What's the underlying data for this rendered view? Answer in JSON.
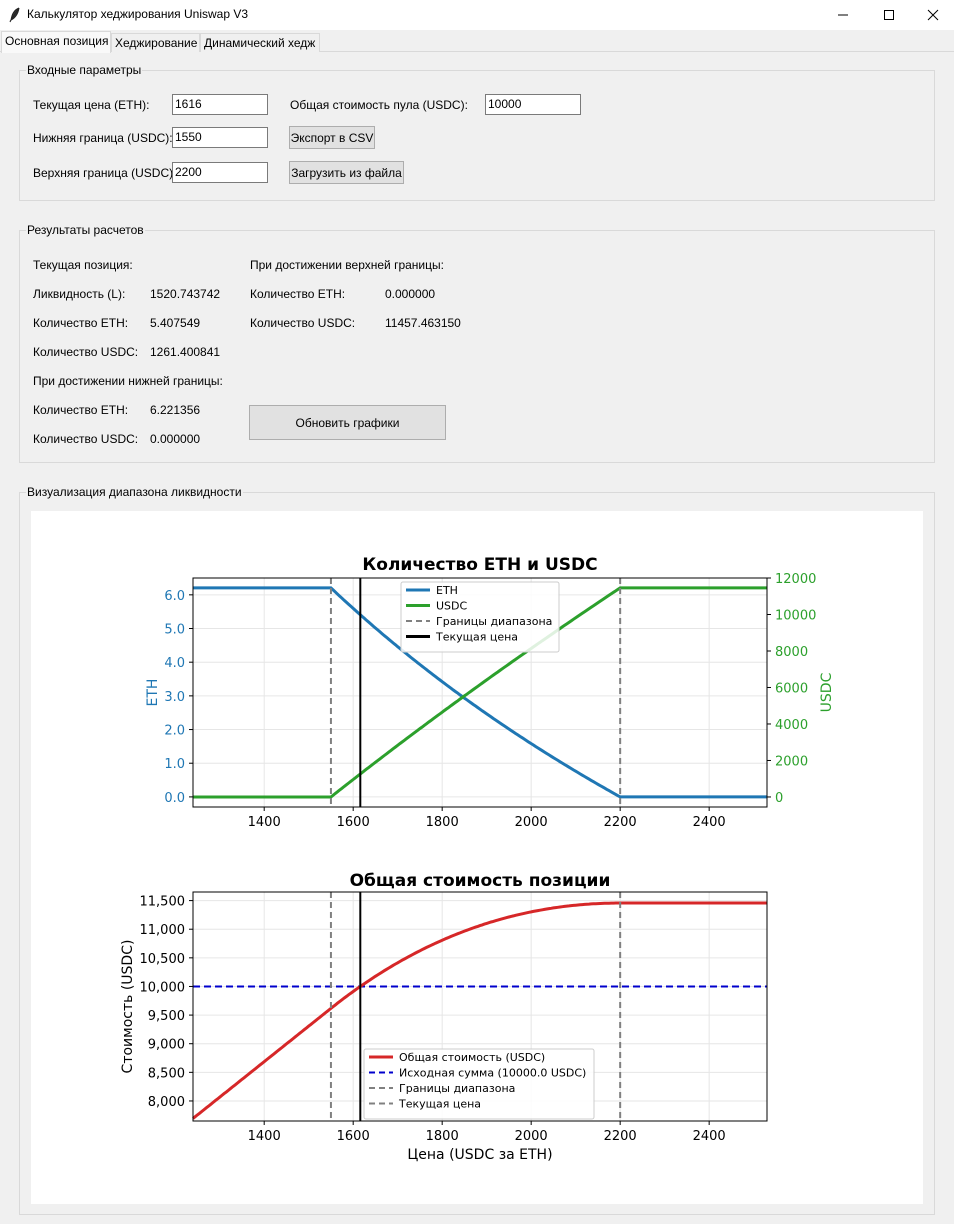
{
  "window": {
    "title": "Калькулятор хеджирования Uniswap V3",
    "icon": "feather-icon"
  },
  "tabs": [
    {
      "label": "Основная позиция"
    },
    {
      "label": "Хеджирование"
    },
    {
      "label": "Динамический хедж"
    }
  ],
  "inputs": {
    "title": "Входные параметры",
    "current_price_label": "Текущая цена (ETH):",
    "current_price": "1616",
    "lower_label": "Нижняя граница (USDC):",
    "lower": "1550",
    "upper_label": "Верхняя граница (USDC):",
    "upper": "2200",
    "pool_label": "Общая стоимость пула (USDC):",
    "pool": "10000",
    "export_button": "Экспорт в CSV",
    "load_button": "Загрузить из файла"
  },
  "results": {
    "title": "Результаты расчетов",
    "current_heading": "Текущая позиция:",
    "liquidity_label": "Ликвидность (L):",
    "liquidity": "1520.743742",
    "eth_label": "Количество ETH:",
    "eth": "5.407549",
    "usdc_label": "Количество USDC:",
    "usdc": "1261.400841",
    "lower_heading": "При достижении нижней границы:",
    "lower_eth_label": "Количество ETH:",
    "lower_eth": "6.221356",
    "lower_usdc_label": "Количество USDC:",
    "lower_usdc": "0.000000",
    "upper_heading": "При достижении верхней границы:",
    "upper_eth_label": "Количество ETH:",
    "upper_eth": "0.000000",
    "upper_usdc_label": "Количество USDC:",
    "upper_usdc": "11457.463150",
    "update_button": "Обновить графики"
  },
  "viz": {
    "title": "Визуализация диапазона ликвидности"
  },
  "chart_data": [
    {
      "type": "line",
      "title": "Количество ETH и USDC",
      "xlabel": "",
      "ylabel": "ETH",
      "y2label": "USDC",
      "xlim": [
        1240,
        2530
      ],
      "ylim": [
        -0.3,
        6.5
      ],
      "y2lim": [
        -550,
        12000
      ],
      "xticks": [
        1400,
        1600,
        1800,
        2000,
        2200,
        2400
      ],
      "yticks": [
        0.0,
        1.0,
        2.0,
        3.0,
        4.0,
        5.0,
        6.0
      ],
      "y2ticks": [
        0,
        2000,
        4000,
        6000,
        8000,
        10000,
        12000
      ],
      "grid": true,
      "legend": "upper center",
      "lower_bound": 1550,
      "upper_bound": 2200,
      "current_price": 1616,
      "liquidity": 1520.743742,
      "series": [
        {
          "name": "ETH",
          "color": "#1f77b4",
          "axis": "left",
          "style": "solid"
        },
        {
          "name": "USDC",
          "color": "#2ca02c",
          "axis": "right",
          "style": "solid"
        },
        {
          "name": "Границы диапазона",
          "color": "#808080",
          "style": "dashed"
        },
        {
          "name": "Текущая цена",
          "color": "#000000",
          "style": "solid"
        }
      ]
    },
    {
      "type": "line",
      "title": "Общая стоимость позиции",
      "xlabel": "Цена (USDC за ETH)",
      "ylabel": "Стоимость (USDC)",
      "xlim": [
        1240,
        2530
      ],
      "ylim": [
        7650,
        11650
      ],
      "xticks": [
        1400,
        1600,
        1800,
        2000,
        2200,
        2400
      ],
      "yticks": [
        8000,
        8500,
        9000,
        9500,
        10000,
        10500,
        11000,
        11500
      ],
      "ytick_labels": [
        "8,000",
        "8,500",
        "9,000",
        "9,500",
        "10,000",
        "10,500",
        "11,000",
        "11,500"
      ],
      "grid": true,
      "legend": "lower center",
      "lower_bound": 1550,
      "upper_bound": 2200,
      "current_price": 1616,
      "initial_value": 10000.0,
      "series": [
        {
          "name": "Общая стоимость (USDC)",
          "color": "#d62728",
          "style": "solid"
        },
        {
          "name": "Исходная сумма (10000.0 USDC)",
          "color": "#0000cc",
          "style": "dashed"
        },
        {
          "name": "Границы диапазона",
          "color": "#808080",
          "style": "dashed"
        },
        {
          "name": "Текущая цена",
          "color": "#808080",
          "style": "dashed"
        }
      ]
    }
  ]
}
